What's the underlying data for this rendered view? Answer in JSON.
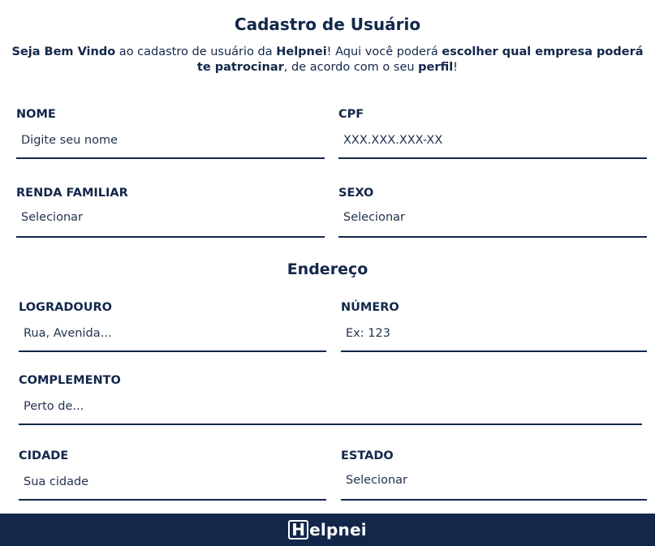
{
  "header": {
    "title": "Cadastro de Usuário",
    "intro": {
      "p1": "Seja Bem Vindo",
      "p2": " ao cadastro de usuário da ",
      "p3": "Helpnei",
      "p4": "! Aqui você poderá ",
      "p5": "escolher qual empresa poderá te patrocinar",
      "p6": ", de acordo com o seu ",
      "p7": "perfil",
      "p8": "!"
    }
  },
  "personal": {
    "nome": {
      "label": "NOME",
      "placeholder": "Digite seu nome"
    },
    "cpf": {
      "label": "CPF",
      "placeholder": "XXX.XXX.XXX-XX"
    },
    "renda": {
      "label": "RENDA FAMILIAR",
      "value": "Selecionar"
    },
    "sexo": {
      "label": "SEXO",
      "value": "Selecionar"
    }
  },
  "address": {
    "section_title": "Endereço",
    "logradouro": {
      "label": "LOGRADOURO",
      "placeholder": "Rua, Avenida..."
    },
    "numero": {
      "label": "NÚMERO",
      "placeholder": "Ex: 123"
    },
    "complemento": {
      "label": "COMPLEMENTO",
      "placeholder": "Perto de..."
    },
    "cidade": {
      "label": "CIDADE",
      "placeholder": "Sua cidade"
    },
    "estado": {
      "label": "ESTADO",
      "value": "Selecionar"
    }
  },
  "footer": {
    "logo_initial": "H",
    "logo_rest": "elpnei"
  },
  "colors": {
    "primary": "#12274a",
    "background": "#ffffff"
  }
}
